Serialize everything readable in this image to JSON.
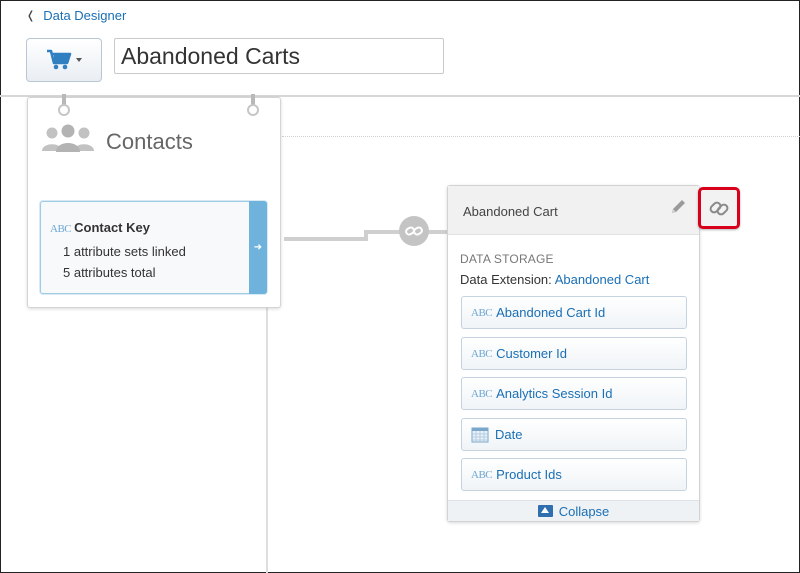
{
  "breadcrumb": {
    "back_label": "Data Designer"
  },
  "header": {
    "icon_picker": {
      "icon": "shopping-cart-icon"
    },
    "title_value": "Abandoned Carts"
  },
  "contacts_card": {
    "title": "Contacts",
    "key": {
      "type_badge": "ABC",
      "name": "Contact Key",
      "lines": [
        "1 attribute sets linked",
        "5 attributes total"
      ]
    }
  },
  "cart_card": {
    "title": "Abandoned Cart",
    "storage_label": "DATA STORAGE",
    "extension_prefix": "Data Extension:",
    "extension_name": "Abandoned Cart",
    "fields": [
      {
        "label": "Abandoned Cart Id",
        "type": "ABC"
      },
      {
        "label": "Customer Id",
        "type": "ABC"
      },
      {
        "label": "Analytics Session Id",
        "type": "ABC"
      },
      {
        "label": "Date",
        "type": "calendar-icon"
      },
      {
        "label": "Product Ids",
        "type": "ABC"
      }
    ],
    "collapse_label": "Collapse"
  },
  "colors": {
    "accent": "#1a6fb5",
    "highlight": "#d9001b",
    "key_tab": "#6fb3dc"
  }
}
